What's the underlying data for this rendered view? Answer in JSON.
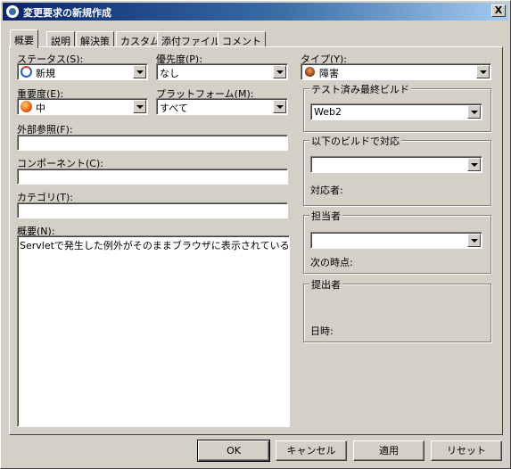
{
  "window": {
    "title": "変更要求の新規作成",
    "close_label": "X"
  },
  "tabs": [
    "概要",
    "説明",
    "解決策",
    "カスタム",
    "添付ファイル",
    "コメント"
  ],
  "form": {
    "status": {
      "label": "ステータス(S):",
      "value": "新規",
      "icon": "new-status-icon"
    },
    "priority": {
      "label": "優先度(P):",
      "value": "なし"
    },
    "type": {
      "label": "タイプ(Y):",
      "value": "障害",
      "icon": "bug-icon"
    },
    "severity": {
      "label": "重要度(E):",
      "value": "中",
      "icon": "severity-icon"
    },
    "platform": {
      "label": "プラットフォーム(M):",
      "value": "すべて"
    },
    "external_ref": {
      "label": "外部参照(F):",
      "value": ""
    },
    "component": {
      "label": "コンポーネント(C):",
      "value": ""
    },
    "category": {
      "label": "カテゴリ(T):",
      "value": ""
    },
    "summary": {
      "label": "概要(N):",
      "value": "Servletで発生した例外がそのままブラウザに表示されている"
    }
  },
  "groups": {
    "tested_build": {
      "legend": "テスト済み最終ビルド",
      "value": "Web2"
    },
    "fixed_in_build": {
      "legend": "以下のビルドで対応",
      "value": "",
      "sub_label": "対応者:"
    },
    "assignee": {
      "legend": "担当者",
      "value": "",
      "sub_label": "次の時点:"
    },
    "submitter": {
      "legend": "提出者",
      "sub_label": "日時:"
    }
  },
  "buttons": {
    "ok": "OK",
    "cancel": "キャンセル",
    "apply": "適用",
    "reset": "リセット"
  }
}
